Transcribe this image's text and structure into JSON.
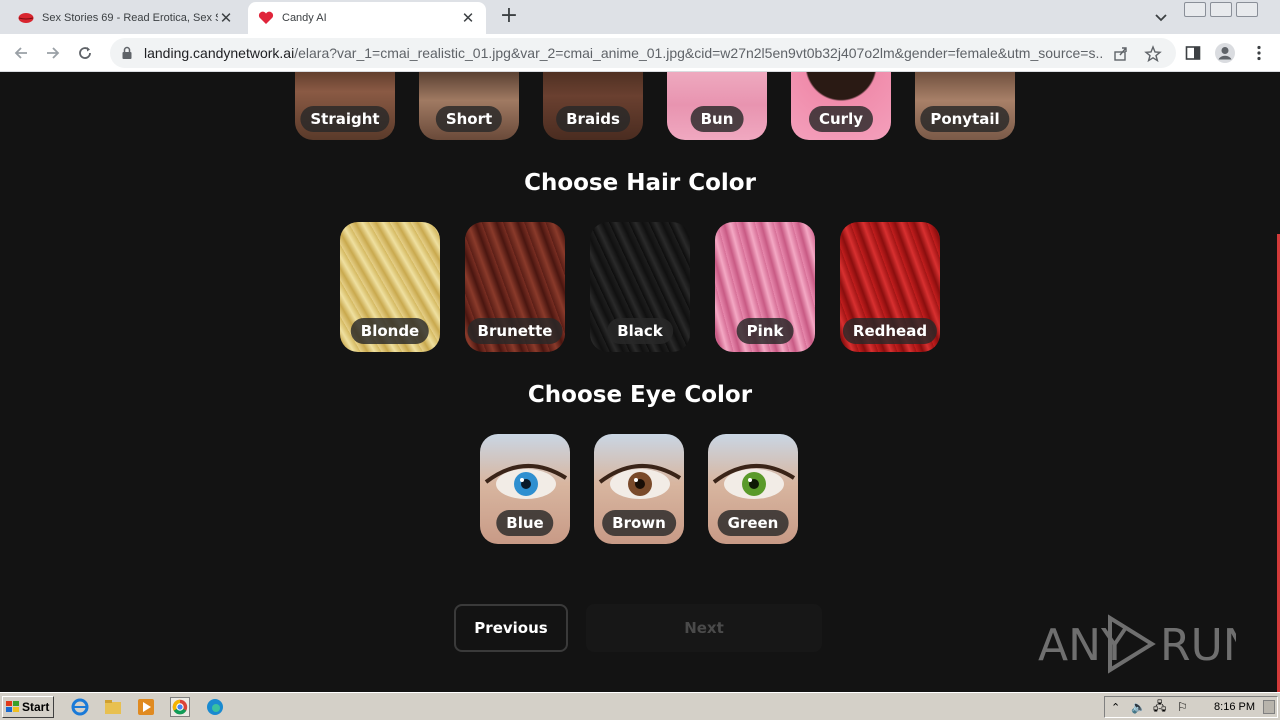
{
  "browser": {
    "tabs": [
      {
        "title": "Sex Stories 69 - Read Erotica, Sex St",
        "icon": "lips-icon"
      },
      {
        "title": "Candy AI",
        "icon": "heart-icon"
      }
    ],
    "url_host": "landing.candynetwork.ai",
    "url_rest": "/elara?var_1=cmai_realistic_01.jpg&var_2=cmai_anime_01.jpg&cid=w27n2l5en9vt0b32j407o2lm&gender=female&utm_source=s..."
  },
  "hair_styles": [
    {
      "label": "Straight",
      "color": "#6b4a3a"
    },
    {
      "label": "Short",
      "color": "#7a5a48"
    },
    {
      "label": "Braids",
      "color": "#5a3a2c"
    },
    {
      "label": "Bun",
      "color": "#e9a0b8"
    },
    {
      "label": "Curly",
      "color": "#f08cab"
    },
    {
      "label": "Ponytail",
      "color": "#8b6a58"
    }
  ],
  "hair_color_section": {
    "title": "Choose Hair Color",
    "options": [
      {
        "label": "Blonde",
        "color": "#d8c070"
      },
      {
        "label": "Brunette",
        "color": "#6a2a20"
      },
      {
        "label": "Black",
        "color": "#161616"
      },
      {
        "label": "Pink",
        "color": "#e07aa0"
      },
      {
        "label": "Redhead",
        "color": "#b01a1a"
      }
    ]
  },
  "eye_color_section": {
    "title": "Choose Eye Color",
    "options": [
      {
        "label": "Blue",
        "color": "#2f8fd0"
      },
      {
        "label": "Brown",
        "color": "#7a4a2a"
      },
      {
        "label": "Green",
        "color": "#5a9a2a"
      }
    ]
  },
  "buttons": {
    "previous": "Previous",
    "next": "Next"
  },
  "watermark": "ANY RUN",
  "taskbar": {
    "start": "Start",
    "clock": "8:16 PM"
  }
}
